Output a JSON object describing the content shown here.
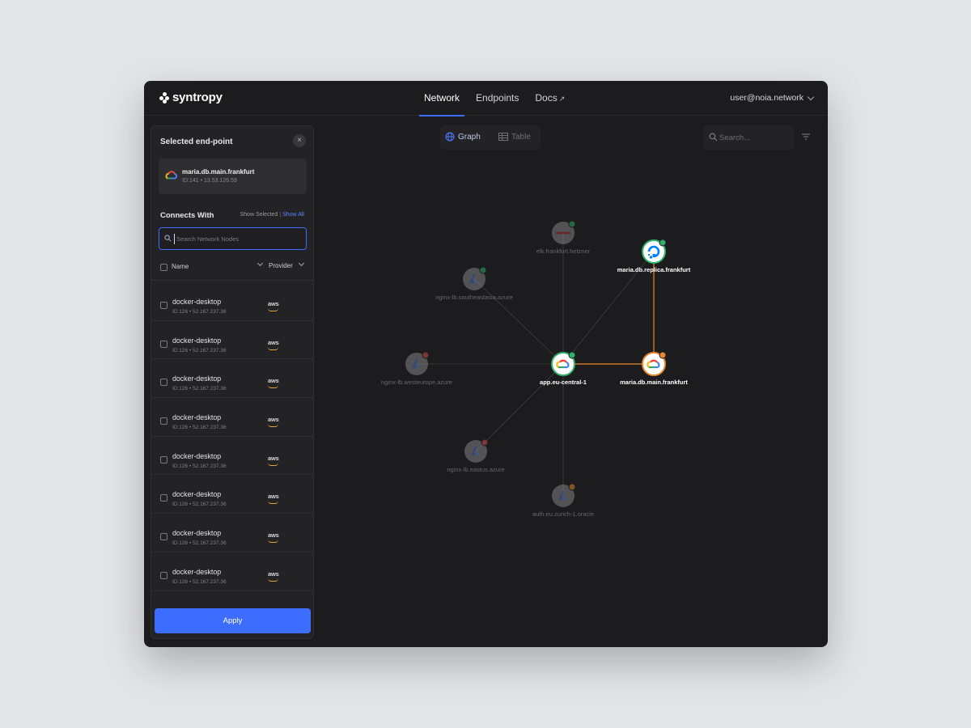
{
  "header": {
    "logo_text": "syntropy",
    "nav": [
      {
        "label": "Network",
        "active": true
      },
      {
        "label": "Endpoints",
        "active": false
      },
      {
        "label": "Docs",
        "active": false,
        "external": true
      }
    ],
    "nav_external_glyph": "↗",
    "user_email": "user@noia.network"
  },
  "panel": {
    "title": "Selected end-point",
    "close_glyph": "×",
    "selected": {
      "name": "maria.db.main.frankfurt",
      "meta": "ID:141 • 13.53.126.59",
      "icon": "google-cloud-icon"
    },
    "connects_with": {
      "title": "Connects With",
      "show_selected": "Show Selected",
      "separator": "|",
      "show_all": "Show All"
    },
    "search_placeholder": "Search Network Nodes",
    "columns": {
      "name": "Name",
      "provider": "Provider"
    },
    "rows": [
      {
        "name": "docker-desktop",
        "meta": "ID:126 • 52.167.237.36",
        "provider": "aws"
      },
      {
        "name": "docker-desktop",
        "meta": "ID:126 • 52.167.237.36",
        "provider": "aws"
      },
      {
        "name": "docker-desktop",
        "meta": "ID:126 • 52.167.237.36",
        "provider": "aws"
      },
      {
        "name": "docker-desktop",
        "meta": "ID:126 • 52.167.237.36",
        "provider": "aws"
      },
      {
        "name": "docker-desktop",
        "meta": "ID:126 • 52.167.237.36",
        "provider": "aws"
      },
      {
        "name": "docker-desktop",
        "meta": "ID:126 • 52.167.237.36",
        "provider": "aws"
      },
      {
        "name": "docker-desktop",
        "meta": "ID:126 • 52.167.237.36",
        "provider": "aws"
      },
      {
        "name": "docker-desktop",
        "meta": "ID:126 • 52.167.237.36",
        "provider": "aws"
      }
    ],
    "apply_label": "Apply"
  },
  "graph_toolbar": {
    "view_graph": "Graph",
    "view_table": "Table",
    "active_view": "graph",
    "search_placeholder": "Search..."
  },
  "graph": {
    "colors": {
      "accent": "#3d6dff",
      "warning": "#e8882e",
      "ok": "#2fb36a",
      "error": "#d94a4a",
      "edge": "#4a4a4e"
    },
    "nodes": [
      {
        "id": "hetzner",
        "label": "elk.frankfurt.hetzner",
        "provider": "hetzner-icon",
        "status": "ok",
        "dimmed": true
      },
      {
        "id": "do",
        "label": "maria.db.replica.frankfurt",
        "provider": "digitalocean-icon",
        "status": "ok",
        "dimmed": false
      },
      {
        "id": "azure-se",
        "label": "nginx-lb.southeastasia.azure",
        "provider": "azure-icon",
        "status": "ok",
        "dimmed": true
      },
      {
        "id": "azure-we",
        "label": "nginx-lb.westeurope.azure",
        "provider": "azure-icon",
        "status": "error",
        "dimmed": true
      },
      {
        "id": "app",
        "label": "app.eu-central-1",
        "provider": "google-cloud-icon",
        "status": "ok",
        "dimmed": false
      },
      {
        "id": "maria",
        "label": "maria.db.main.frankfurt",
        "provider": "google-cloud-icon",
        "status": "warning",
        "dimmed": false,
        "selected": true
      },
      {
        "id": "azure-us",
        "label": "nginx-lb.eastus.azure",
        "provider": "azure-icon",
        "status": "error",
        "dimmed": true
      },
      {
        "id": "oracle",
        "label": "auth.eu.zurich-1.oracle",
        "provider": "azure-icon",
        "status": "warning",
        "dimmed": true
      }
    ],
    "edges": [
      {
        "from": "app",
        "to": "hetzner",
        "highlight": false
      },
      {
        "from": "app",
        "to": "do",
        "highlight": false
      },
      {
        "from": "app",
        "to": "azure-se",
        "highlight": false
      },
      {
        "from": "app",
        "to": "azure-we",
        "highlight": false
      },
      {
        "from": "app",
        "to": "maria",
        "highlight": true
      },
      {
        "from": "app",
        "to": "azure-us",
        "highlight": false
      },
      {
        "from": "app",
        "to": "oracle",
        "highlight": false
      },
      {
        "from": "maria",
        "to": "do",
        "highlight": true
      }
    ]
  }
}
